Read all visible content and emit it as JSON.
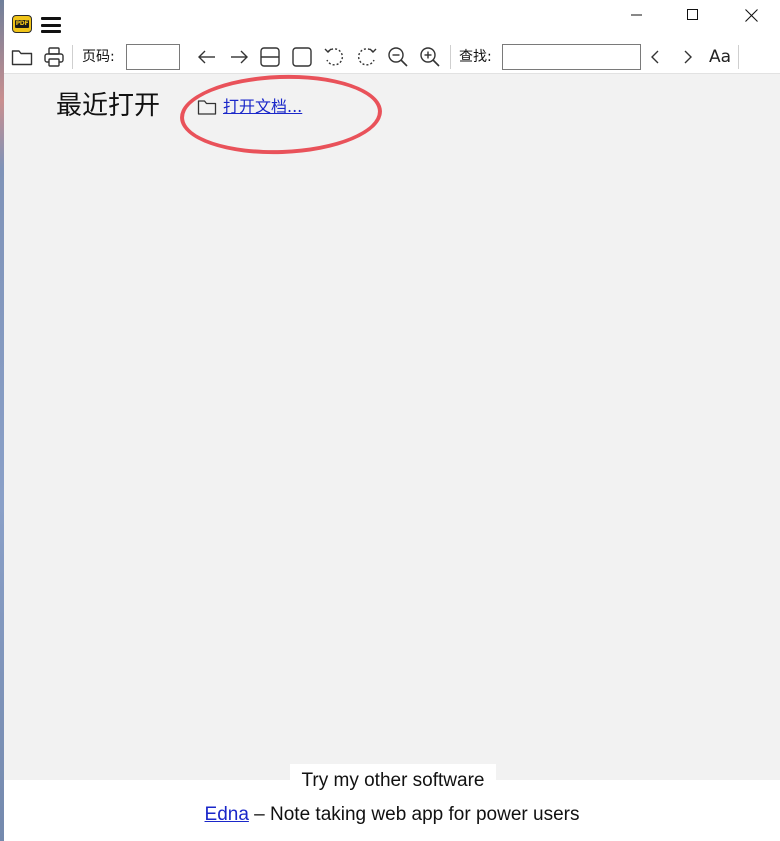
{
  "window": {
    "logo_text": "PDF"
  },
  "toolbar": {
    "page_label": "页码:",
    "page_value": "",
    "find_label": "查找:",
    "find_value": "",
    "match_case_label": "Aa"
  },
  "main": {
    "recent_title": "最近打开",
    "open_document_label": "打开文档..."
  },
  "footer": {
    "tab_label": "Try my other software",
    "link_label": "Edna",
    "description": " – Note taking web app for power users"
  },
  "colors": {
    "content_bg": "#f2f2f2",
    "link": "#1a27c9",
    "annotation": "#e9525a",
    "logo": "#f0c419"
  }
}
